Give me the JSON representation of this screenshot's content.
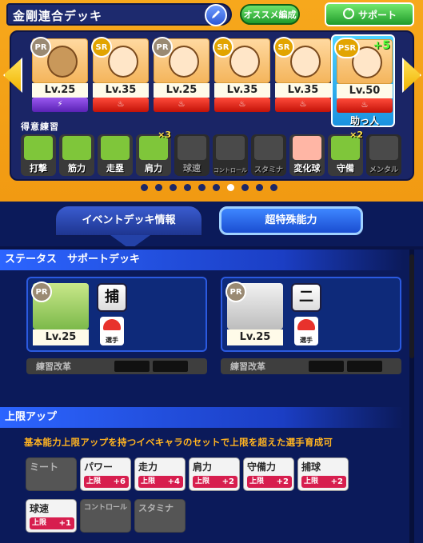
{
  "deck": {
    "title": "金剛連合デッキ",
    "recommend_label": "オススメ編成",
    "support_label": "サポート",
    "skills_title": "得意練習"
  },
  "cards": [
    {
      "rarity": "PR",
      "level": "Lv.25",
      "type": "purple"
    },
    {
      "rarity": "SR",
      "level": "Lv.35",
      "type": "red"
    },
    {
      "rarity": "PR",
      "level": "Lv.25",
      "type": "red"
    },
    {
      "rarity": "SR",
      "level": "Lv.35",
      "type": "red"
    },
    {
      "rarity": "SR",
      "level": "Lv.35",
      "type": "red"
    }
  ],
  "helper": {
    "rarity": "PSR",
    "level": "Lv.50",
    "plus": "+5",
    "label": "助っ人"
  },
  "skills": [
    {
      "label": "打撃",
      "active": true,
      "mult": ""
    },
    {
      "label": "筋力",
      "active": true,
      "mult": ""
    },
    {
      "label": "走塁",
      "active": true,
      "mult": ""
    },
    {
      "label": "肩力",
      "active": true,
      "mult": "×3"
    },
    {
      "label": "球速",
      "active": false,
      "mult": ""
    },
    {
      "label": "コントロール",
      "active": false,
      "mult": ""
    },
    {
      "label": "スタミナ",
      "active": false,
      "mult": ""
    },
    {
      "label": "変化球",
      "active": true,
      "mult": ""
    },
    {
      "label": "守備",
      "active": true,
      "mult": "×2"
    },
    {
      "label": "メンタル",
      "active": false,
      "mult": ""
    }
  ],
  "pagination": {
    "total": 9,
    "active": 6
  },
  "tabs": {
    "event": "イベントデッキ情報",
    "super": "超特殊能力"
  },
  "status": {
    "header": "ステータス　サポートデッキ",
    "cards": [
      {
        "rarity": "PR",
        "level": "Lv.25",
        "position": "捕",
        "player_label": "選手",
        "practice_label": "練習改革"
      },
      {
        "rarity": "PR",
        "level": "Lv.25",
        "position": "二",
        "player_label": "選手",
        "practice_label": "練習改革"
      }
    ]
  },
  "limit": {
    "header": "上限アップ",
    "description": "基本能力上限アップを持つイベキャラのセットで上限を超えた選手育成可",
    "badge_prefix": "上限",
    "abilities": [
      {
        "name": "ミート",
        "value": "",
        "active": false
      },
      {
        "name": "パワー",
        "value": "+6",
        "active": true
      },
      {
        "name": "走力",
        "value": "+4",
        "active": true
      },
      {
        "name": "肩力",
        "value": "+2",
        "active": true
      },
      {
        "name": "守備力",
        "value": "+2",
        "active": true
      },
      {
        "name": "捕球",
        "value": "+2",
        "active": true
      },
      {
        "name": "球速",
        "value": "+1",
        "active": true
      },
      {
        "name": "コントロール",
        "value": "",
        "active": false
      },
      {
        "name": "スタミナ",
        "value": "",
        "active": false
      }
    ]
  },
  "colors": {
    "panel_orange": "#f7a81c",
    "navy": "#0b1a5a",
    "header_blue": "#2c65ff",
    "badge_red": "#d71e4e",
    "desc_orange": "#ffb320"
  }
}
